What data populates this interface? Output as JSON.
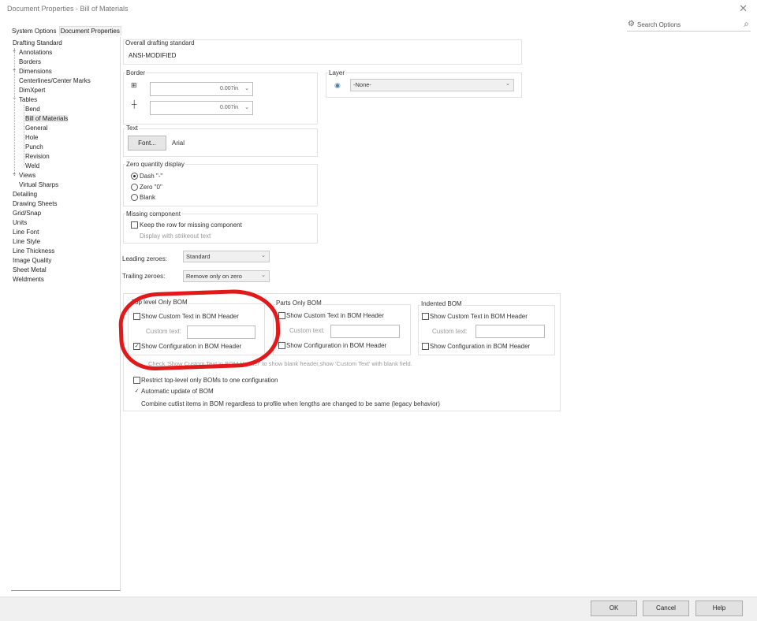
{
  "window": {
    "title": "Document Properties - Bill of Materials",
    "close_glyph": "✕"
  },
  "tabs": [
    {
      "label": "System Options"
    },
    {
      "label": "Document Properties"
    }
  ],
  "search": {
    "placeholder": "Search Options"
  },
  "tree": {
    "items": [
      {
        "label": "Drafting Standard"
      },
      {
        "label": "Annotations"
      },
      {
        "label": "Borders"
      },
      {
        "label": "Dimensions"
      },
      {
        "label": "Centerlines/Center Marks"
      },
      {
        "label": "DimXpert"
      },
      {
        "label": "Tables"
      },
      {
        "label": "Bend"
      },
      {
        "label": "Bill of Materials"
      },
      {
        "label": "General"
      },
      {
        "label": "Hole"
      },
      {
        "label": "Punch"
      },
      {
        "label": "Revision"
      },
      {
        "label": "Weld"
      },
      {
        "label": "Views"
      },
      {
        "label": "Virtual Sharps"
      },
      {
        "label": "Detailing"
      },
      {
        "label": "Drawing Sheets"
      },
      {
        "label": "Grid/Snap"
      },
      {
        "label": "Units"
      },
      {
        "label": "Line Font"
      },
      {
        "label": "Line Style"
      },
      {
        "label": "Line Thickness"
      },
      {
        "label": "Image Quality"
      },
      {
        "label": "Sheet Metal"
      },
      {
        "label": "Weldments"
      }
    ],
    "expanders": {
      "plus": "+",
      "minus": "−"
    }
  },
  "overall": {
    "label": "Overall drafting standard",
    "value": "ANSI-MODIFIED"
  },
  "border": {
    "label": "Border",
    "row1": {
      "icon": "⊞",
      "value": "0.007in"
    },
    "row2": {
      "icon": "┼",
      "value": "0.007in"
    }
  },
  "layer": {
    "label": "Layer",
    "value": "-None-"
  },
  "text": {
    "label": "Text",
    "font_button": "Font...",
    "font_name": "Arial"
  },
  "zero_qty": {
    "label": "Zero quantity display",
    "options": [
      {
        "label": "Dash \"-\"",
        "selected": true
      },
      {
        "label": "Zero \"0\"",
        "selected": false
      },
      {
        "label": "Blank",
        "selected": false
      }
    ]
  },
  "missing": {
    "label": "Missing component",
    "keep_row": "Keep the row for missing component",
    "strikeout": "Display with strikeout text"
  },
  "leading": {
    "label": "Leading zeroes:",
    "value": "Standard"
  },
  "trailing": {
    "label": "Trailing zeroes:",
    "value": "Remove only on zero"
  },
  "bom": {
    "top": {
      "title": "Top level Only BOM",
      "custom": "Show Custom Text in BOM Header",
      "custom_label": "Custom text:",
      "config": "Show Configuration in BOM Header",
      "config_checked": true
    },
    "parts": {
      "title": "Parts Only BOM",
      "custom": "Show Custom Text in BOM Header",
      "custom_label": "Custom text:",
      "config": "Show Configuration in BOM Header",
      "config_checked": false
    },
    "indented": {
      "title": "Indented BOM",
      "custom": "Show Custom Text in BOM Header",
      "custom_label": "Custom text:",
      "config": "Show Configuration in BOM Header",
      "config_checked": false
    },
    "note": "Check 'Show Custom Text in BOM Header' to show blank header,show 'Custom Text' with blank field.",
    "restrict": "Restrict top-level only BOMs to one configuration",
    "auto_update": "Automatic update of BOM",
    "combine": "Combine cutlist items in BOM regardless to profile when lengths are changed to be same (legacy behavior)"
  },
  "footer": {
    "ok": "OK",
    "cancel": "Cancel",
    "help": "Help"
  },
  "colors": {
    "annotation": "#e01a1a"
  }
}
